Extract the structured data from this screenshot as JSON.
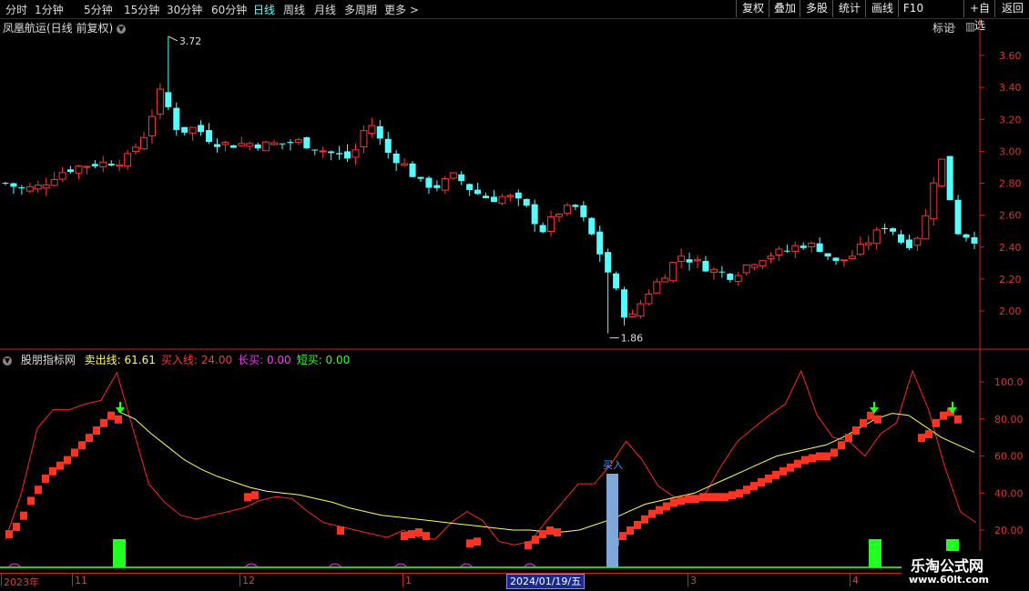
{
  "toolbar": {
    "periods": [
      "分时",
      "1分钟",
      "5分钟",
      "15分钟",
      "30分钟",
      "60分钟",
      "日线",
      "周线",
      "月线",
      "多周期",
      "更多 >"
    ],
    "active_period": "日线",
    "right_buttons": [
      "复权",
      "叠加",
      "多股",
      "统计",
      "画线",
      "F10",
      "+自选",
      "返回"
    ],
    "mark_label": "标记"
  },
  "main_chart": {
    "title": "凤凰航运(日线 前复权)",
    "y_ticks": [
      "3.60",
      "3.40",
      "3.20",
      "3.00",
      "2.80",
      "2.60",
      "2.40",
      "2.20",
      "2.00"
    ],
    "high_label": "3.72",
    "low_label": "1.86"
  },
  "indicator": {
    "name": "股朋指标网",
    "fields": [
      {
        "label": "卖出线:",
        "value": "61.61",
        "color": "#ffff55"
      },
      {
        "label": "买入线:",
        "value": "24.00",
        "color": "#ff3333"
      },
      {
        "label": "长买:",
        "value": "0.00",
        "color": "#ff33ff"
      },
      {
        "label": "短买:",
        "value": "0.00",
        "color": "#33ff33"
      }
    ],
    "y_ticks": [
      "100.0",
      "80.00",
      "60.00",
      "40.00",
      "20.00"
    ],
    "buy_label": "买入"
  },
  "date_axis": {
    "labels": [
      "2023年",
      "11",
      "12",
      "1",
      "3",
      "4"
    ],
    "selected": "2024/01/19/五"
  },
  "watermark": {
    "line1": "乐淘公式网",
    "line2": "www.60lt.com"
  },
  "colors": {
    "up": "#ff3333",
    "down": "#55ffff",
    "sell_line": "#ffff55",
    "signal_green": "#22ff22",
    "buy_bar": "#7fa8d8",
    "axis": "#cc2222"
  },
  "chart_data": {
    "type": "line",
    "title": "凤凰航运(日线 前复权)",
    "y_range_price": [
      1.8,
      3.75
    ],
    "price_close_approx": [
      2.8,
      2.76,
      2.78,
      2.86,
      2.9,
      2.92,
      2.93,
      2.95,
      3.1,
      3.38,
      3.12,
      3.15,
      3.06,
      3.04,
      3.05,
      3.04,
      3.05,
      3.06,
      3.02,
      2.98,
      2.95,
      3.2,
      3.0,
      2.92,
      2.8,
      2.78,
      2.85,
      2.75,
      2.7,
      2.72,
      2.66,
      2.5,
      2.62,
      2.65,
      2.45,
      2.2,
      1.92,
      2.1,
      2.22,
      2.35,
      2.3,
      2.25,
      2.22,
      2.3,
      2.35,
      2.37,
      2.42,
      2.4,
      2.3,
      2.35,
      2.45,
      2.55,
      2.4,
      2.5,
      3.0,
      2.5,
      2.45
    ],
    "indicator": {
      "y_range": [
        10,
        115
      ],
      "sell_line": 61.61,
      "buy_line": 24.0,
      "long_buy": 0.0,
      "short_buy": 0.0
    }
  }
}
